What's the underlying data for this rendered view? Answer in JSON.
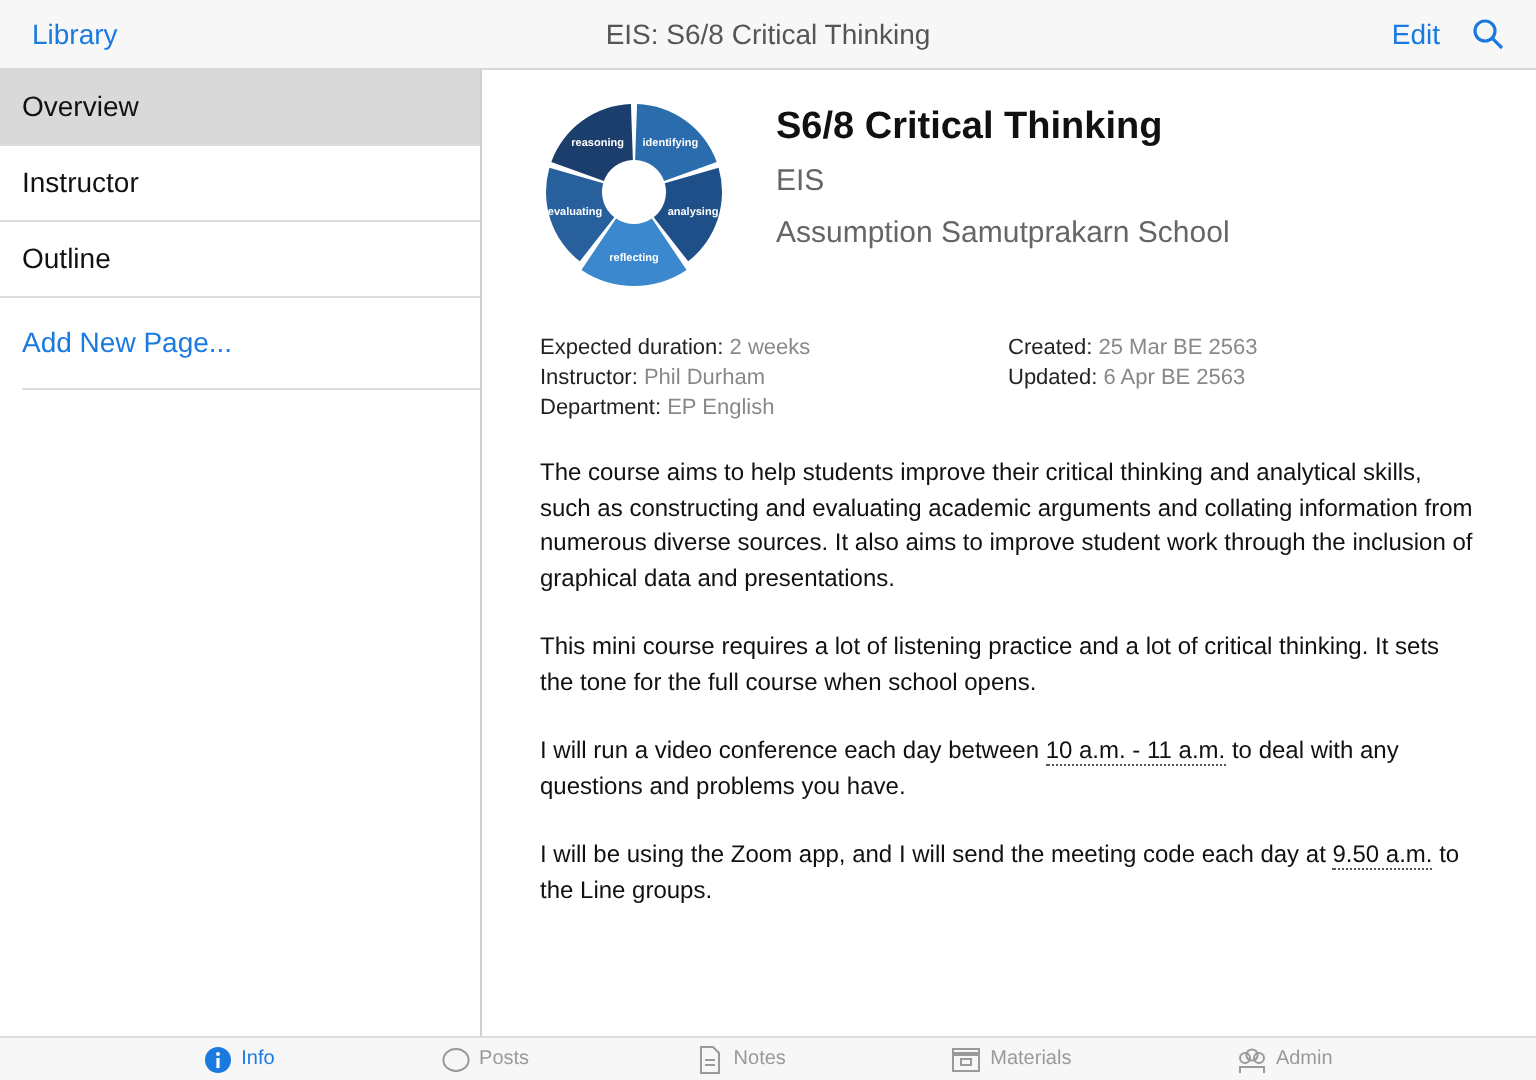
{
  "nav_bar": {
    "back": "Library",
    "title": "EIS: S6/8 Critical Thinking",
    "edit": "Edit"
  },
  "sidebar": {
    "items": [
      {
        "label": "Overview",
        "selected": true
      },
      {
        "label": "Instructor",
        "selected": false
      },
      {
        "label": "Outline",
        "selected": false
      }
    ],
    "add_page": "Add New Page..."
  },
  "course": {
    "title": "S6/8 Critical Thinking",
    "code": "EIS",
    "school": "Assumption Samutprakarn School",
    "diagram": {
      "segments": [
        {
          "label": "identifying",
          "color": "#2b6cad"
        },
        {
          "label": "analysing",
          "color": "#1e4f88"
        },
        {
          "label": "reflecting",
          "color": "#3b88cf"
        },
        {
          "label": "evaluating",
          "color": "#28609e"
        },
        {
          "label": "reasoning",
          "color": "#1b3e6c"
        }
      ]
    },
    "details_left": [
      {
        "label": "Expected duration:",
        "value": "2 weeks"
      },
      {
        "label": "Instructor:",
        "value": "Phil Durham"
      },
      {
        "label": "Department:",
        "value": "EP English"
      }
    ],
    "details_right": [
      {
        "label": "Created:",
        "value": "25 Mar BE 2563"
      },
      {
        "label": "Updated:",
        "value": "6 Apr BE 2563"
      }
    ],
    "paragraphs": [
      [
        {
          "text": "The course aims to help students improve their critical thinking and analytical skills, such as constructing and evaluating academic arguments and collating information from numerous diverse sources. It also aims to improve student work through the inclusion of graphical data and presentations.",
          "link": false
        }
      ],
      [
        {
          "text": "This mini course requires a lot of listening practice and a lot of critical thinking. It sets the tone for the full course when school opens.",
          "link": false
        }
      ],
      [
        {
          "text": "I will run a video conference each day between ",
          "link": false
        },
        {
          "text": "10 a.m. - 11 a.m.",
          "link": true
        },
        {
          "text": " to deal with any questions and problems you have.",
          "link": false
        }
      ],
      [
        {
          "text": "I will be using the Zoom app, and I will send the meeting code each day at ",
          "link": false
        },
        {
          "text": "9.50 a.m.",
          "link": true
        },
        {
          "text": " to the Line groups.",
          "link": false
        }
      ]
    ]
  },
  "tab_bar": [
    {
      "kind": "info",
      "label": "Info",
      "selected": true
    },
    {
      "kind": "posts",
      "label": "Posts",
      "selected": false
    },
    {
      "kind": "notes",
      "label": "Notes",
      "selected": false
    },
    {
      "kind": "materials",
      "label": "Materials",
      "selected": false
    },
    {
      "kind": "admin",
      "label": "Admin",
      "selected": false
    }
  ]
}
